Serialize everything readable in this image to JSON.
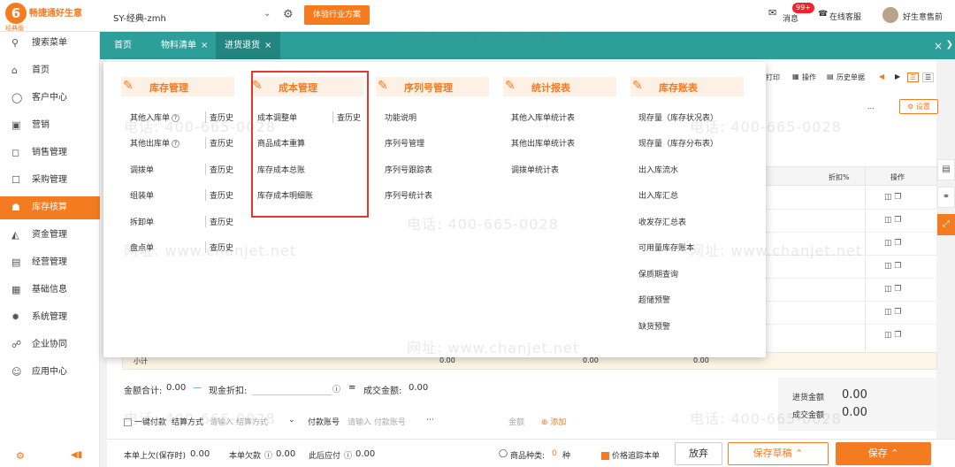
{
  "topbar": {
    "brand": "畅捷通好生意",
    "brand_sub": "经典版",
    "account": "SY-经典-zmh",
    "trial_button": "体验行业方案",
    "messages": "消息",
    "message_badge": "99+",
    "online_service": "在线客服",
    "user": "好生意售前"
  },
  "sidebar": {
    "items": [
      {
        "label": "搜索菜单",
        "icon": "search-icon"
      },
      {
        "label": "首页",
        "icon": "home-icon"
      },
      {
        "label": "客户中心",
        "icon": "customer-icon"
      },
      {
        "label": "营销",
        "icon": "gift-icon"
      },
      {
        "label": "销售管理",
        "icon": "sales-icon"
      },
      {
        "label": "采购管理",
        "icon": "purchase-icon"
      },
      {
        "label": "库存核算",
        "icon": "inventory-icon"
      },
      {
        "label": "资金管理",
        "icon": "fund-icon"
      },
      {
        "label": "经营管理",
        "icon": "report-icon"
      },
      {
        "label": "基础信息",
        "icon": "info-icon"
      },
      {
        "label": "系统管理",
        "icon": "system-icon"
      },
      {
        "label": "企业协同",
        "icon": "collab-icon"
      },
      {
        "label": "应用中心",
        "icon": "app-icon"
      }
    ],
    "active_index": 6
  },
  "tabs": [
    {
      "label": "首页"
    },
    {
      "label": "物料清单"
    },
    {
      "label": "进货退货"
    }
  ],
  "toolbar": {
    "print": "打印",
    "operate": "操作",
    "history": "历史单据",
    "settings": "设置",
    "more": "..."
  },
  "grid": {
    "col_discount": "折扣%",
    "col_ops": "操作"
  },
  "subtotal": {
    "label": "小计",
    "v1": "0.00",
    "v2": "0.00",
    "v3": "0.00"
  },
  "totals": {
    "amount_label": "金额合计:",
    "amount": "0.00",
    "cash_discount_label": "现金折扣:",
    "deal_label": "成交金额:",
    "deal": "0.00",
    "box_purchase_label": "进货金额",
    "box_purchase": "0.00",
    "box_deal_label": "成交金额",
    "box_deal": "0.00"
  },
  "payment": {
    "onekey": "一键付款",
    "settle": "结算方式",
    "settle_ph": "请输入 结算方式",
    "account": "付款账号",
    "account_ph": "请输入 付款账号",
    "amount": "金额",
    "add": "添加"
  },
  "footer": {
    "debt_label": "本单上欠(保存时)",
    "debt": "0.00",
    "owe_label": "本单欠款",
    "owe": "0.00",
    "after_label": "此后应付",
    "after": "0.00",
    "kinds_label": "商品种类:",
    "kinds": "0",
    "kinds_unit": "种",
    "track": "价格追踪本单",
    "discard": "放弃",
    "draft": "保存草稿",
    "save": "保存"
  },
  "mega_menu": {
    "columns": [
      {
        "title": "库存管理",
        "icon": "inventory-mgmt-icon",
        "items": [
          {
            "label": "其他入库单",
            "help": "?",
            "history": "查历史"
          },
          {
            "label": "其他出库单",
            "help": "?",
            "history": "查历史"
          },
          {
            "label": "调拨单",
            "history": "查历史"
          },
          {
            "label": "组装单",
            "history": "查历史"
          },
          {
            "label": "拆卸单",
            "history": "查历史"
          },
          {
            "label": "盘点单",
            "history": "查历史"
          }
        ]
      },
      {
        "title": "成本管理",
        "icon": "cost-mgmt-icon",
        "items": [
          {
            "label": "成本调整单",
            "history": "查历史"
          },
          {
            "label": "商品成本重算"
          },
          {
            "label": "库存成本总账"
          },
          {
            "label": "库存成本明细账"
          }
        ]
      },
      {
        "title": "序列号管理",
        "icon": "serial-mgmt-icon",
        "items": [
          {
            "label": "功能说明"
          },
          {
            "label": "序列号管理"
          },
          {
            "label": "序列号跟踪表"
          },
          {
            "label": "序列号统计表"
          }
        ]
      },
      {
        "title": "统计报表",
        "icon": "stats-report-icon",
        "items": [
          {
            "label": "其他入库单统计表"
          },
          {
            "label": "其他出库单统计表"
          },
          {
            "label": "调拨单统计表"
          }
        ]
      },
      {
        "title": "库存账表",
        "icon": "inventory-ledger-icon",
        "items": [
          {
            "label": "现存量（库存状况表）"
          },
          {
            "label": "现存量（库存分布表）"
          },
          {
            "label": "出入库流水"
          },
          {
            "label": "出入库汇总"
          },
          {
            "label": "收发存汇总表"
          },
          {
            "label": "可用量库存账本"
          },
          {
            "label": "保质期查询"
          },
          {
            "label": "超储预警"
          },
          {
            "label": "缺货预警"
          }
        ]
      }
    ]
  },
  "watermark": {
    "phone": "电话: 400-665-0028",
    "site": "网址: www.chanjet.net"
  },
  "colors": {
    "accent": "#f47b20",
    "tabbar": "#2c9f9a",
    "highlight_box": "#e23a2a"
  }
}
